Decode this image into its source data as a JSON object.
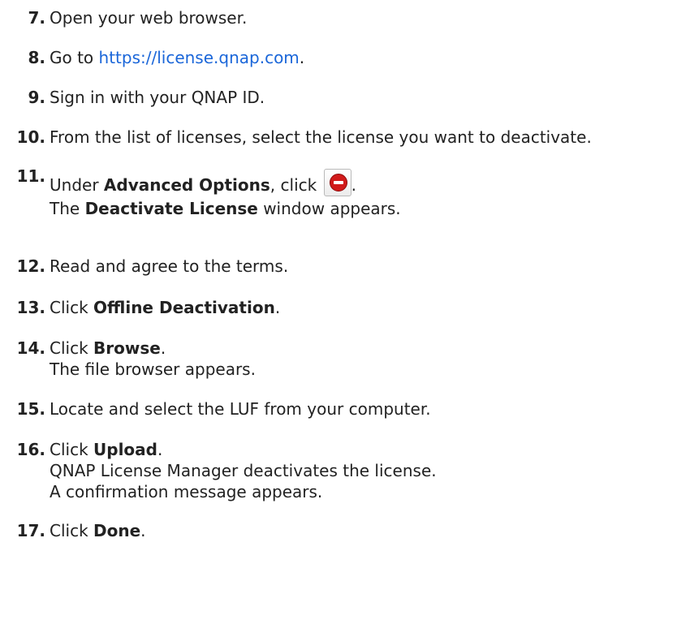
{
  "steps": [
    {
      "number": "7.",
      "text": "Open your web browser."
    },
    {
      "number": "8.",
      "pre": "Go to ",
      "link": "https://license.qnap.com",
      "post": "."
    },
    {
      "number": "9.",
      "text": "Sign in with your QNAP ID."
    },
    {
      "number": "10.",
      "text": "From the list of licenses, select the license you want to deactivate."
    },
    {
      "number": "11.",
      "pre": "Under ",
      "bold": "Advanced Options",
      "mid": ", click ",
      "post": ".",
      "icon": "deactivate-icon",
      "line2_pre": "The ",
      "line2_bold": "Deactivate License",
      "line2_post": " window appears."
    },
    {
      "number": "12.",
      "text": "Read and agree to the terms."
    },
    {
      "number": "13.",
      "pre": "Click ",
      "bold": "Offline Deactivation",
      "post": "."
    },
    {
      "number": "14.",
      "pre": "Click ",
      "bold": "Browse",
      "post": ".",
      "line2": "The file browser appears."
    },
    {
      "number": "15.",
      "text": "Locate and select the LUF from your computer."
    },
    {
      "number": "16.",
      "pre": "Click ",
      "bold": "Upload",
      "post": ".",
      "line2": "QNAP License Manager deactivates the license.",
      "line3": "A confirmation message appears."
    },
    {
      "number": "17.",
      "pre": "Click ",
      "bold": "Done",
      "post": "."
    }
  ],
  "colors": {
    "link": "#1a66d9",
    "icon_red": "#d11a1a"
  }
}
